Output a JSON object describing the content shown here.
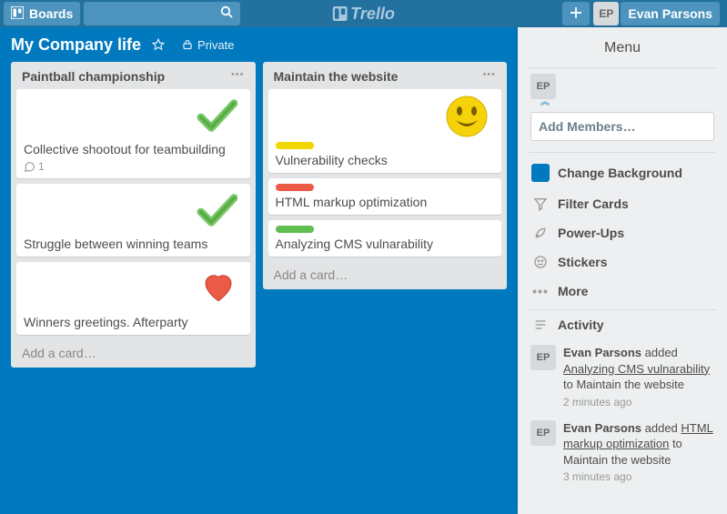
{
  "header": {
    "boards_label": "Boards",
    "user_initials": "EP",
    "user_name": "Evan Parsons",
    "logo_text": "Trello"
  },
  "board": {
    "title": "My Company life",
    "privacy_label": "Private"
  },
  "lists": [
    {
      "title": "Paintball championship",
      "add_label": "Add a card…",
      "cards": [
        {
          "title": "Collective shootout for teambuilding",
          "sticker": "check",
          "comment_count": "1"
        },
        {
          "title": "Struggle between winning teams",
          "sticker": "check"
        },
        {
          "title": "Winners greetings. Afterparty",
          "sticker": "heart"
        }
      ]
    },
    {
      "title": "Maintain the website",
      "add_label": "Add a card…",
      "cards": [
        {
          "title": "Vulnerability checks",
          "sticker": "smile",
          "label": "yellow"
        },
        {
          "title": "HTML markup optimization",
          "label": "red"
        },
        {
          "title": "Analyzing CMS vulnarability",
          "label": "green"
        }
      ]
    }
  ],
  "menu": {
    "title": "Menu",
    "member_initials": "EP",
    "add_members_label": "Add Members…",
    "items": {
      "change_bg": "Change Background",
      "filter": "Filter Cards",
      "powerups": "Power-Ups",
      "stickers": "Stickers",
      "more": "More",
      "activity": "Activity"
    }
  },
  "activity": [
    {
      "initials": "EP",
      "actor": "Evan Parsons",
      "verb": "added",
      "target": "Analyzing CMS vulnarability",
      "dest": "Maintain the website",
      "time": "2 minutes ago"
    },
    {
      "initials": "EP",
      "actor": "Evan Parsons",
      "verb": "added",
      "target": "HTML markup optimization",
      "dest": "Maintain the website",
      "time": "3 minutes ago"
    }
  ]
}
